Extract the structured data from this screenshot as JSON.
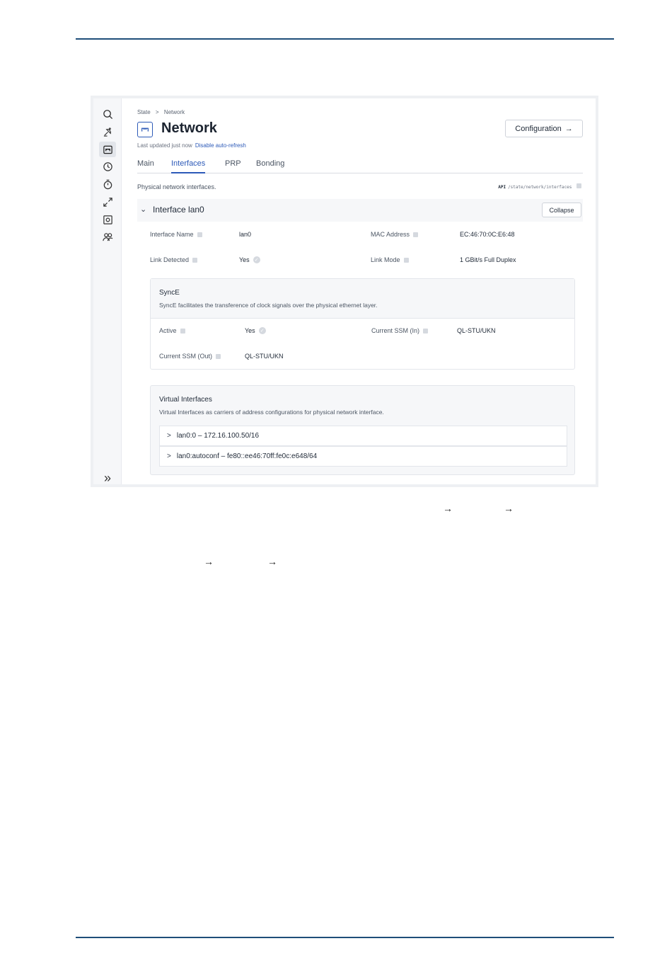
{
  "breadcrumb": {
    "root": "State",
    "separator": ">",
    "current": "Network"
  },
  "page": {
    "title": "Network",
    "updated_text": "Last updated just now",
    "auto_refresh_link": "Disable auto-refresh",
    "config_button": "Configuration",
    "config_arrow": "→"
  },
  "tabs": [
    {
      "label": "Main",
      "active": false
    },
    {
      "label": "Interfaces",
      "active": true
    },
    {
      "label": "PRP",
      "active": false
    },
    {
      "label": "Bonding",
      "active": false
    }
  ],
  "section": {
    "description": "Physical network interfaces.",
    "api_label": "API",
    "api_path": "/state/network/interfaces"
  },
  "interface": {
    "chevron": "⌄",
    "title": "Interface lan0",
    "collapse_button": "Collapse",
    "name_label": "Interface Name",
    "name_value": "lan0",
    "mac_label": "MAC Address",
    "mac_value": "EC:46:70:0C:E6:48",
    "link_label": "Link Detected",
    "link_value": "Yes",
    "mode_label": "Link Mode",
    "mode_value": "1 GBit/s Full Duplex"
  },
  "synce": {
    "title": "SyncE",
    "subtitle": "SyncE facilitates the transference of clock signals over the physical ethernet layer.",
    "active_label": "Active",
    "active_value": "Yes",
    "ssm_in_label": "Current SSM (In)",
    "ssm_in_value": "QL-STU/UKN",
    "ssm_out_label": "Current SSM (Out)",
    "ssm_out_value": "QL-STU/UKN"
  },
  "virtual": {
    "title": "Virtual Interfaces",
    "subtitle": "Virtual Interfaces as carriers of address configurations for physical network interface.",
    "rows": [
      {
        "chevron": ">",
        "label": "lan0:0 – 172.16.100.50/16"
      },
      {
        "chevron": ">",
        "label": "lan0:autoconf – fe80::ee46:70ff:fe0c:e648/64"
      }
    ]
  },
  "rail": {
    "expand_glyph": "»"
  },
  "doc_arrows": {
    "arrow": "→"
  },
  "colors": {
    "accent": "#2d5ab8",
    "rule": "#1f4e79"
  }
}
